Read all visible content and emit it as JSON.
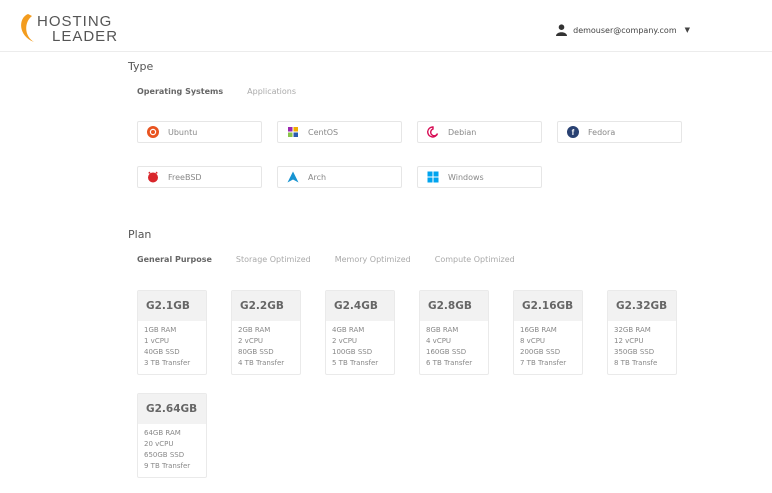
{
  "brand": {
    "line1": "HOSTING",
    "line2": "LEADER",
    "accent": "#f39c1e"
  },
  "user": {
    "email": "demouser@company.com",
    "icon": "user-icon",
    "caret": "▼"
  },
  "type": {
    "title": "Type",
    "tabs": [
      "Operating Systems",
      "Applications"
    ],
    "active_tab": "Operating Systems",
    "os": [
      {
        "label": "Ubuntu",
        "icon": "ubuntu-icon",
        "color": "#e95420"
      },
      {
        "label": "CentOS",
        "icon": "centos-icon",
        "color": "#9c27b0"
      },
      {
        "label": "Debian",
        "icon": "debian-icon",
        "color": "#d70a53"
      },
      {
        "label": "Fedora",
        "icon": "fedora-icon",
        "color": "#294172"
      },
      {
        "label": "FreeBSD",
        "icon": "freebsd-icon",
        "color": "#d9262b"
      },
      {
        "label": "Arch",
        "icon": "arch-icon",
        "color": "#1793d1"
      },
      {
        "label": "Windows",
        "icon": "windows-icon",
        "color": "#00a4ef"
      }
    ]
  },
  "plan": {
    "title": "Plan",
    "tabs": [
      "General Purpose",
      "Storage Optimized",
      "Memory Optimized",
      "Compute Optimized"
    ],
    "active_tab": "General Purpose",
    "plans": [
      {
        "name": "G2.1GB",
        "specs": [
          "1GB RAM",
          "1 vCPU",
          "40GB SSD",
          "3 TB Transfer"
        ]
      },
      {
        "name": "G2.2GB",
        "specs": [
          "2GB RAM",
          "2 vCPU",
          "80GB SSD",
          "4 TB Transfer"
        ]
      },
      {
        "name": "G2.4GB",
        "specs": [
          "4GB RAM",
          "2 vCPU",
          "100GB SSD",
          "5 TB Transfer"
        ]
      },
      {
        "name": "G2.8GB",
        "specs": [
          "8GB RAM",
          "4 vCPU",
          "160GB SSD",
          "6 TB Transfer"
        ]
      },
      {
        "name": "G2.16GB",
        "specs": [
          "16GB RAM",
          "8 vCPU",
          "200GB SSD",
          "7 TB Transfer"
        ]
      },
      {
        "name": "G2.32GB",
        "specs": [
          "32GB RAM",
          "12 vCPU",
          "350GB SSD",
          "8 TB Transfe"
        ]
      },
      {
        "name": "G2.64GB",
        "specs": [
          "64GB RAM",
          "20 vCPU",
          "650GB SSD",
          "9 TB Transfer"
        ]
      }
    ]
  }
}
